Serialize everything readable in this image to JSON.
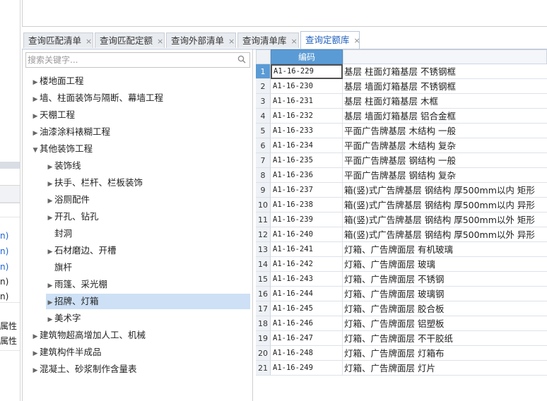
{
  "left_strip": {
    "fragments": [
      {
        "text": "n)",
        "blue": true
      },
      {
        "text": "n)",
        "blue": true
      },
      {
        "text": "n)",
        "blue": true
      },
      {
        "text": "n)",
        "blue": false
      },
      {
        "text": "n)",
        "blue": false
      },
      {
        "text": "属性",
        "blue": false
      },
      {
        "text": "属性",
        "blue": false
      }
    ]
  },
  "tabs": [
    {
      "label": "查询匹配清单",
      "close": "×"
    },
    {
      "label": "查询匹配定额",
      "close": "×"
    },
    {
      "label": "查询外部清单",
      "close": "×"
    },
    {
      "label": "查询清单库",
      "close": "×"
    },
    {
      "label": "查询定额库",
      "close": "×",
      "active": true
    }
  ],
  "search": {
    "placeholder": "搜索关键字..."
  },
  "tree": [
    {
      "label": "楼地面工程",
      "level": 0,
      "caret": "▶"
    },
    {
      "label": "墙、柱面装饰与隔断、幕墙工程",
      "level": 0,
      "caret": "▶"
    },
    {
      "label": "天棚工程",
      "level": 0,
      "caret": "▶"
    },
    {
      "label": "油漆涂料裱糊工程",
      "level": 0,
      "caret": "▶"
    },
    {
      "label": "其他装饰工程",
      "level": 0,
      "caret": "▼"
    },
    {
      "label": "装饰线",
      "level": 1,
      "caret": "▶"
    },
    {
      "label": "扶手、栏杆、栏板装饰",
      "level": 1,
      "caret": "▶"
    },
    {
      "label": "浴厕配件",
      "level": 1,
      "caret": "▶"
    },
    {
      "label": "开孔、钻孔",
      "level": 1,
      "caret": "▶"
    },
    {
      "label": "封洞",
      "level": 1,
      "caret": ""
    },
    {
      "label": "石材磨边、开槽",
      "level": 1,
      "caret": "▶"
    },
    {
      "label": "旗杆",
      "level": 1,
      "caret": ""
    },
    {
      "label": "雨篷、采光棚",
      "level": 1,
      "caret": "▶"
    },
    {
      "label": "招牌、灯箱",
      "level": 1,
      "caret": "▶",
      "selected": true
    },
    {
      "label": "美术字",
      "level": 1,
      "caret": "▶"
    },
    {
      "label": "建筑物超高增加人工、机械",
      "level": 0,
      "caret": "▶"
    },
    {
      "label": "建筑构件半成品",
      "level": 0,
      "caret": "▶"
    },
    {
      "label": "混凝土、砂浆制作含量表",
      "level": 0,
      "caret": "▶"
    }
  ],
  "table": {
    "header_code": "编码",
    "rows": [
      {
        "num": "1",
        "code": "A1-16-229",
        "name": "基层 柱面灯箱基层 不锈钢框"
      },
      {
        "num": "2",
        "code": "A1-16-230",
        "name": "基层 墙面灯箱基层 不锈钢框"
      },
      {
        "num": "3",
        "code": "A1-16-231",
        "name": "基层 柱面灯箱基层 木框"
      },
      {
        "num": "4",
        "code": "A1-16-232",
        "name": "基层 墙面灯箱基层 铝合金框"
      },
      {
        "num": "5",
        "code": "A1-16-233",
        "name": "平面广告牌基层 木结构 一般"
      },
      {
        "num": "6",
        "code": "A1-16-234",
        "name": "平面广告牌基层 木结构 复杂"
      },
      {
        "num": "7",
        "code": "A1-16-235",
        "name": "平面广告牌基层 钢结构 一般"
      },
      {
        "num": "8",
        "code": "A1-16-236",
        "name": "平面广告牌基层 钢结构 复杂"
      },
      {
        "num": "9",
        "code": "A1-16-237",
        "name": "箱(竖)式广告牌基层 钢结构 厚500mm以内 矩形"
      },
      {
        "num": "10",
        "code": "A1-16-238",
        "name": "箱(竖)式广告牌基层 钢结构 厚500mm以内 异形"
      },
      {
        "num": "11",
        "code": "A1-16-239",
        "name": "箱(竖)式广告牌基层 钢结构 厚500mm以外 矩形"
      },
      {
        "num": "12",
        "code": "A1-16-240",
        "name": "箱(竖)式广告牌基层 钢结构 厚500mm以外 异形"
      },
      {
        "num": "13",
        "code": "A1-16-241",
        "name": "灯箱、广告牌面层 有机玻璃"
      },
      {
        "num": "14",
        "code": "A1-16-242",
        "name": "灯箱、广告牌面层 玻璃"
      },
      {
        "num": "15",
        "code": "A1-16-243",
        "name": "灯箱、广告牌面层 不锈钢"
      },
      {
        "num": "16",
        "code": "A1-16-244",
        "name": "灯箱、广告牌面层 玻璃钢"
      },
      {
        "num": "17",
        "code": "A1-16-245",
        "name": "灯箱、广告牌面层 胶合板"
      },
      {
        "num": "18",
        "code": "A1-16-246",
        "name": "灯箱、广告牌面层 铝塑板"
      },
      {
        "num": "19",
        "code": "A1-16-247",
        "name": "灯箱、广告牌面层 不干胶纸"
      },
      {
        "num": "20",
        "code": "A1-16-248",
        "name": "灯箱、广告牌面层 灯箱布"
      },
      {
        "num": "21",
        "code": "A1-16-249",
        "name": "灯箱、广告牌面层 灯片"
      }
    ]
  },
  "colors": {
    "accent": "#5b9bd5",
    "selected_row": "#cde0f5",
    "active_tab_text": "#1f5fbf"
  }
}
